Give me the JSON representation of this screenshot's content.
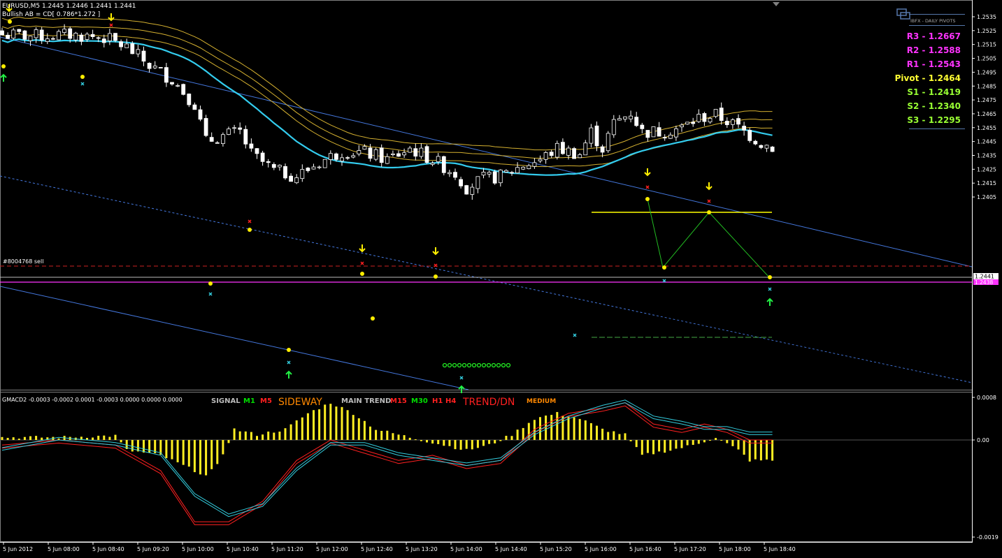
{
  "header": {
    "symbol_line": "EURUSD,M5  1.2445 1.2446 1.2441 1.2441",
    "pattern_line": "Bullish AB = CD[ 0.786*1.272 ]"
  },
  "order_label": "#8004768 sell",
  "pivots": {
    "title": "IBFX - DAILY PIVOTS",
    "levels": [
      {
        "label": "R3 - 1.2667",
        "color": "#ff33ff"
      },
      {
        "label": "R2 - 1.2588",
        "color": "#ff33ff"
      },
      {
        "label": "R1 - 1.2543",
        "color": "#ff33ff"
      },
      {
        "label": "Pivot - 1.2464",
        "color": "#ffff33"
      },
      {
        "label": "S1 - 1.2419",
        "color": "#99ff33"
      },
      {
        "label": "S2 - 1.2340",
        "color": "#99ff33"
      },
      {
        "label": "S3 - 1.2295",
        "color": "#99ff33"
      }
    ]
  },
  "indicator": {
    "name": "GMACD2 -0.0003 -0.0002 0.0001 -0.0003 0.0000 0.0000 0.0000",
    "signal_label": "SIGNAL",
    "signal_items": [
      {
        "text": "M1",
        "color": "#00dd00"
      },
      {
        "text": "M5",
        "color": "#ff2020"
      }
    ],
    "signal_state": "SIDEWAY",
    "main_trend_label": "MAIN TREND",
    "trend_items": [
      {
        "text": "M15",
        "color": "#ff2020"
      },
      {
        "text": "M30",
        "color": "#00dd00"
      },
      {
        "text": "H1",
        "color": "#ff2020"
      },
      {
        "text": "H4",
        "color": "#ff2020"
      }
    ],
    "trend_state": "TREND/DN",
    "strength": "MEDIUM"
  },
  "colors": {
    "candle": "#ffffff",
    "ma_main": "#33ccee",
    "ma_bands": "#d4b030",
    "channel": "#4477dd",
    "order_line": "#cc2222",
    "pivot_line": "#ff33ff",
    "macd_hist": "#ffee22",
    "macd_main": "#ff2020",
    "macd_signal": "#33ccdd",
    "axis": "#ffffff"
  },
  "chart_data": [
    {
      "type": "candlestick",
      "symbol": "EURUSD",
      "timeframe": "M5",
      "ylim": [
        1.24,
        1.254
      ],
      "y_ticks": [
        "1.2535",
        "1.2525",
        "1.2515",
        "1.2505",
        "1.2495",
        "1.2485",
        "1.2475",
        "1.2465",
        "1.2455",
        "1.2445",
        "1.2435",
        "1.2425",
        "1.2415",
        "1.2405"
      ],
      "current_price": "1.2441",
      "bid_box": "1.2438",
      "x_ticks": [
        "5 Jun 2012",
        "5 Jun 08:00",
        "5 Jun 08:40",
        "5 Jun 09:20",
        "5 Jun 10:00",
        "5 Jun 10:40",
        "5 Jun 11:20",
        "5 Jun 12:00",
        "5 Jun 12:40",
        "5 Jun 13:20",
        "5 Jun 14:00",
        "5 Jun 14:40",
        "5 Jun 15:20",
        "5 Jun 16:00",
        "5 Jun 16:40",
        "5 Jun 17:20",
        "5 Jun 18:00",
        "5 Jun 18:40"
      ],
      "close_path": [
        [
          0,
          1.2522
        ],
        [
          6,
          1.2521
        ],
        [
          12,
          1.2522
        ],
        [
          18,
          1.252
        ],
        [
          22,
          1.2513
        ],
        [
          26,
          1.25
        ],
        [
          30,
          1.249
        ],
        [
          34,
          1.2472
        ],
        [
          36,
          1.2445
        ],
        [
          38,
          1.2448
        ],
        [
          42,
          1.2452
        ],
        [
          44,
          1.2436
        ],
        [
          48,
          1.2424
        ],
        [
          52,
          1.242
        ],
        [
          56,
          1.243
        ],
        [
          60,
          1.2438
        ],
        [
          64,
          1.2437
        ],
        [
          68,
          1.2432
        ],
        [
          72,
          1.244
        ],
        [
          76,
          1.2432
        ],
        [
          80,
          1.2422
        ],
        [
          82,
          1.2412
        ],
        [
          85,
          1.2418
        ],
        [
          88,
          1.242
        ],
        [
          92,
          1.2428
        ],
        [
          95,
          1.2432
        ],
        [
          98,
          1.244
        ],
        [
          102,
          1.2436
        ],
        [
          104,
          1.2452
        ],
        [
          106,
          1.244
        ],
        [
          108,
          1.2458
        ],
        [
          111,
          1.2466
        ],
        [
          113,
          1.2452
        ],
        [
          116,
          1.2452
        ],
        [
          120,
          1.2455
        ],
        [
          123,
          1.2462
        ],
        [
          126,
          1.2464
        ],
        [
          128,
          1.246
        ],
        [
          130,
          1.2455
        ],
        [
          134,
          1.2444
        ],
        [
          136,
          1.2441
        ]
      ],
      "horizontal_lines": [
        {
          "name": "order",
          "price": 1.2446
        },
        {
          "name": "pivot-s1",
          "price": 1.2438
        }
      ]
    },
    {
      "type": "bar+line",
      "title": "GMACD2",
      "ylim": [
        -0.0019,
        0.0008
      ],
      "y_ticks": [
        "0.0008",
        "0.00",
        "-0.0019"
      ],
      "histogram_path": [
        [
          0,
          5e-05
        ],
        [
          10,
          5e-05
        ],
        [
          20,
          8e-05
        ],
        [
          22,
          -0.0002
        ],
        [
          28,
          -0.0003
        ],
        [
          36,
          -0.0007
        ],
        [
          38,
          -0.0005
        ],
        [
          41,
          0.0002
        ],
        [
          45,
          0.0001
        ],
        [
          50,
          0.0002
        ],
        [
          54,
          0.0005
        ],
        [
          58,
          0.0007
        ],
        [
          62,
          0.0005
        ],
        [
          66,
          0.0002
        ],
        [
          72,
          5e-05
        ],
        [
          78,
          -0.0001
        ],
        [
          82,
          -0.0002
        ],
        [
          86,
          -0.0001
        ],
        [
          90,
          0.0001
        ],
        [
          94,
          0.0004
        ],
        [
          98,
          0.0005
        ],
        [
          102,
          0.0004
        ],
        [
          106,
          0.0002
        ],
        [
          110,
          0.0001
        ],
        [
          113,
          -0.0003
        ],
        [
          118,
          -0.0002
        ],
        [
          122,
          -0.0001
        ],
        [
          126,
          5e-05
        ],
        [
          130,
          -0.0002
        ],
        [
          132,
          -0.0004
        ]
      ],
      "main_line_path": [
        [
          0,
          -0.0001
        ],
        [
          10,
          0.0
        ],
        [
          20,
          -0.0001
        ],
        [
          28,
          -0.0006
        ],
        [
          34,
          -0.0016
        ],
        [
          40,
          -0.0016
        ],
        [
          46,
          -0.0012
        ],
        [
          52,
          -0.0004
        ],
        [
          58,
          0.0
        ],
        [
          64,
          -0.0002
        ],
        [
          70,
          -0.0004
        ],
        [
          76,
          -0.0003
        ],
        [
          82,
          -0.0005
        ],
        [
          88,
          -0.0004
        ],
        [
          94,
          0.0002
        ],
        [
          100,
          0.0005
        ],
        [
          106,
          0.0006
        ],
        [
          110,
          0.0007
        ],
        [
          115,
          0.0003
        ],
        [
          120,
          0.0002
        ],
        [
          124,
          0.0003
        ],
        [
          128,
          0.0002
        ],
        [
          132,
          0.0
        ]
      ],
      "signal_line_path": [
        [
          0,
          -0.0002
        ],
        [
          10,
          0.0
        ],
        [
          20,
          -0.0001
        ],
        [
          28,
          -0.0003
        ],
        [
          34,
          -0.0011
        ],
        [
          40,
          -0.0015
        ],
        [
          46,
          -0.0013
        ],
        [
          52,
          -0.0006
        ],
        [
          58,
          -0.0001
        ],
        [
          64,
          -0.0001
        ],
        [
          70,
          -0.0003
        ],
        [
          76,
          -0.0004
        ],
        [
          82,
          -0.0005
        ],
        [
          88,
          -0.0004
        ],
        [
          94,
          0.0001
        ],
        [
          100,
          0.0004
        ],
        [
          106,
          0.0006
        ],
        [
          110,
          0.0007
        ],
        [
          115,
          0.0004
        ],
        [
          120,
          0.0003
        ],
        [
          124,
          0.0002
        ],
        [
          128,
          0.0002
        ],
        [
          132,
          0.0001
        ]
      ]
    }
  ]
}
